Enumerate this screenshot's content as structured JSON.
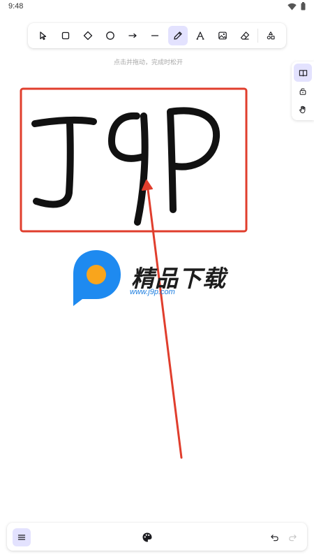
{
  "status_bar": {
    "time": "9:48"
  },
  "toolbar": {
    "tools": [
      "select",
      "rectangle",
      "diamond",
      "ellipse",
      "arrow",
      "line",
      "draw",
      "text",
      "image",
      "eraser",
      "more-shapes"
    ],
    "active_tool": "draw",
    "accent_color": "#e3e2fe",
    "icon_color": "#1b1b1f"
  },
  "hint_text": "点击并拖动，完成时松开",
  "canvas": {
    "handwriting": "J9P",
    "rectangle_color": "#e03e2d",
    "ink_color": "#111111",
    "arrow_color": "#e03e2d"
  },
  "watermark": {
    "title": "精品下载",
    "url": "www.j9p.com",
    "logo_colors": [
      "#1e8af0",
      "#f9a51c"
    ]
  },
  "side_panel": {
    "items": [
      "library-icon",
      "lock-icon",
      "hand-icon"
    ]
  },
  "bottom_bar": {
    "items": [
      "menu-icon",
      "palette-icon",
      "undo-icon",
      "redo-icon"
    ]
  }
}
